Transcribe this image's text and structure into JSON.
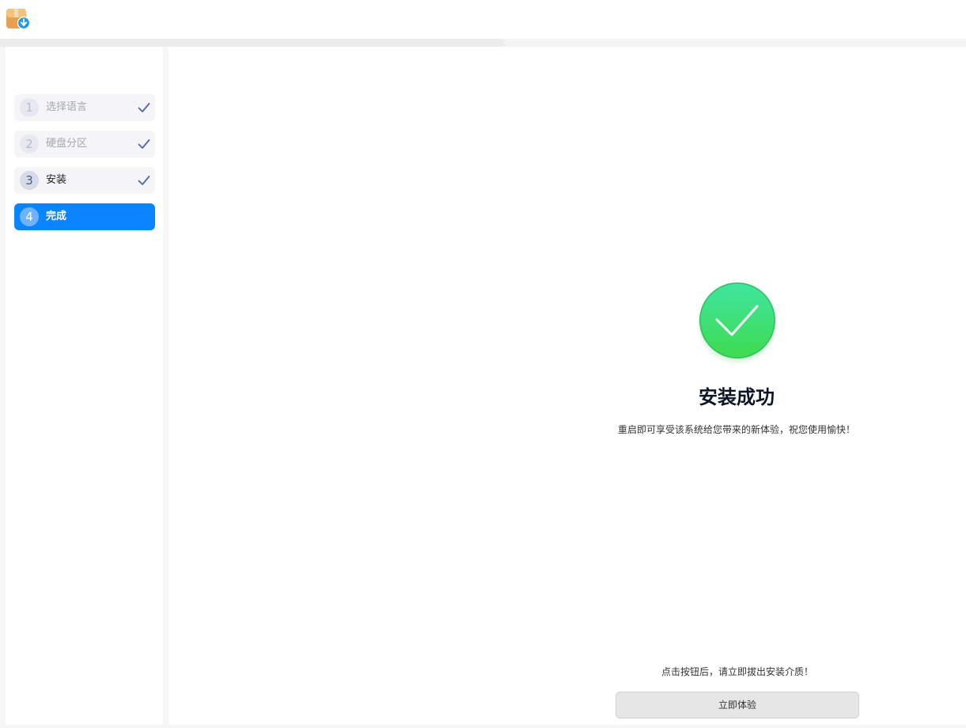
{
  "app": {
    "icon": "package-installer-icon"
  },
  "steps": [
    {
      "number": "1",
      "label": "选择语言",
      "state": "done"
    },
    {
      "number": "2",
      "label": "硬盘分区",
      "state": "done"
    },
    {
      "number": "3",
      "label": "安装",
      "state": "done"
    },
    {
      "number": "4",
      "label": "完成",
      "state": "active"
    }
  ],
  "result": {
    "icon": "success-check-icon",
    "title": "安装成功",
    "description": "重启即可享受该系统给您带来的新体验，祝您使用愉快！"
  },
  "footer": {
    "hint": "点击按钮后，请立即拔出安装介质！",
    "button_label": "立即体验"
  },
  "colors": {
    "accent": "#0a84ff",
    "success": "#3ee072"
  }
}
